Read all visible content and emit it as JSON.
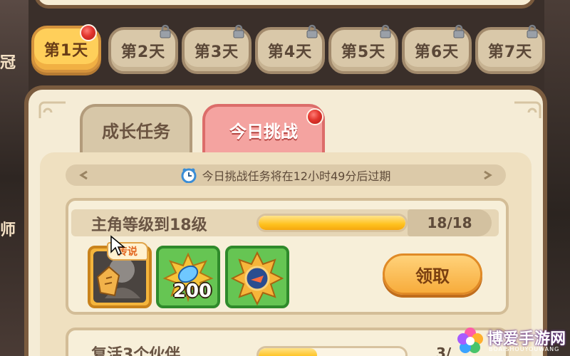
{
  "days": [
    {
      "label": "第1天",
      "active": true,
      "badge": "red-dot"
    },
    {
      "label": "第2天",
      "locked": true
    },
    {
      "label": "第3天",
      "locked": true
    },
    {
      "label": "第4天",
      "locked": true
    },
    {
      "label": "第5天",
      "locked": true
    },
    {
      "label": "第6天",
      "locked": true
    },
    {
      "label": "第7天",
      "locked": true
    }
  ],
  "section_tabs": {
    "growth": "成长任务",
    "daily": "今日挑战"
  },
  "expire_banner": {
    "icon": "clock-icon",
    "text": "今日挑战任务将在12小时49分后过期"
  },
  "task1": {
    "title": "主角等级到18级",
    "progress_text": "18/18",
    "progress_fraction": 1.0,
    "reward_tag": "传说",
    "rewards": [
      {
        "icon": "hero-card-icon"
      },
      {
        "icon": "blue-gem-icon",
        "count": "200"
      },
      {
        "icon": "medal-icon"
      }
    ],
    "claim_label": "领取"
  },
  "task2": {
    "title": "复活3个伙伴",
    "progress_text": "3/"
  },
  "watermark": {
    "text": "博爱手游网",
    "sub": "BOAISHOUYOUWANG"
  },
  "colors": {
    "active_tab": "#ffcf5a",
    "daily_tab": "#f4a3a0",
    "progress": "#ffc21f",
    "claim_button": "#f7ac3c"
  }
}
